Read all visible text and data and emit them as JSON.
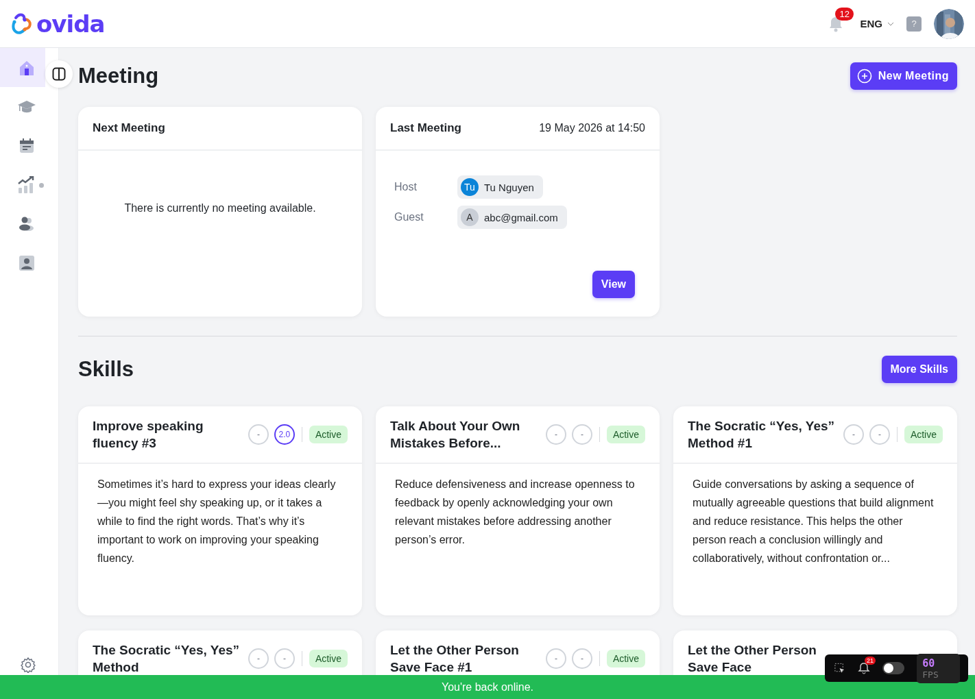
{
  "header": {
    "logo": "ovida",
    "notifications": "12",
    "language": "ENG",
    "help": "?"
  },
  "sidebar": {
    "items": [
      {
        "selected": true,
        "dot": false
      },
      {
        "selected": false,
        "dot": false
      },
      {
        "selected": false,
        "dot": false
      },
      {
        "selected": false,
        "dot": true
      },
      {
        "selected": false,
        "dot": false
      },
      {
        "selected": false,
        "dot": false
      }
    ]
  },
  "meeting": {
    "title": "Meeting",
    "new_button": "New Meeting",
    "next": {
      "title": "Next Meeting",
      "empty": "There is currently no meeting available."
    },
    "last": {
      "title": "Last Meeting",
      "date": "19 May 2026 at 14:50",
      "view_button": "View",
      "people": [
        {
          "role": "Host",
          "initials": "Tu",
          "name": "Tu Nguyen",
          "color": "#0b84d8"
        },
        {
          "role": "Guest",
          "initials": "A",
          "name": "abc@gmail.com",
          "color": "#c9ced6"
        }
      ]
    }
  },
  "skills": {
    "title": "Skills",
    "more_button": "More Skills",
    "cards": [
      {
        "title": "Improve speaking fluency #3",
        "ratings": [
          {
            "text": "-",
            "rated": false
          },
          {
            "text": "2.0",
            "rated": true
          }
        ],
        "status": "Active",
        "description": "Sometimes it’s hard to express your ideas clearly—you might feel shy speaking up, or it takes a while to find the right words. That’s why it’s important to work on improving your speaking fluency."
      },
      {
        "title": "Talk About Your Own Mistakes Before...",
        "ratings": [
          {
            "text": "-",
            "rated": false
          },
          {
            "text": "-",
            "rated": false
          }
        ],
        "status": "Active",
        "description": "Reduce defensiveness and increase openness to feedback by openly acknowledging your own relevant mistakes before addressing another person’s error."
      },
      {
        "title": "The Socratic “Yes, Yes” Method #1",
        "ratings": [
          {
            "text": "-",
            "rated": false
          },
          {
            "text": "-",
            "rated": false
          }
        ],
        "status": "Active",
        "description": "Guide conversations by asking a sequence of mutually agreeable questions that build alignment and reduce resistance. This helps the other person reach a conclusion willingly and collaboratively, without confrontation or..."
      },
      {
        "title": "The Socratic “Yes, Yes” Method",
        "ratings": [
          {
            "text": "-",
            "rated": false
          },
          {
            "text": "-",
            "rated": false
          }
        ],
        "status": "Active"
      },
      {
        "title": "Let the Other Person Save Face #1",
        "ratings": [
          {
            "text": "-",
            "rated": false
          },
          {
            "text": "-",
            "rated": false
          }
        ],
        "status": "Active"
      },
      {
        "title": "Let the Other Person Save Face"
      }
    ]
  },
  "status_bar": {
    "message": "You're back online."
  },
  "dev_toolbar": {
    "notifications": "21",
    "toggle_on": false,
    "fps": "60",
    "fps_label": "FPS"
  }
}
